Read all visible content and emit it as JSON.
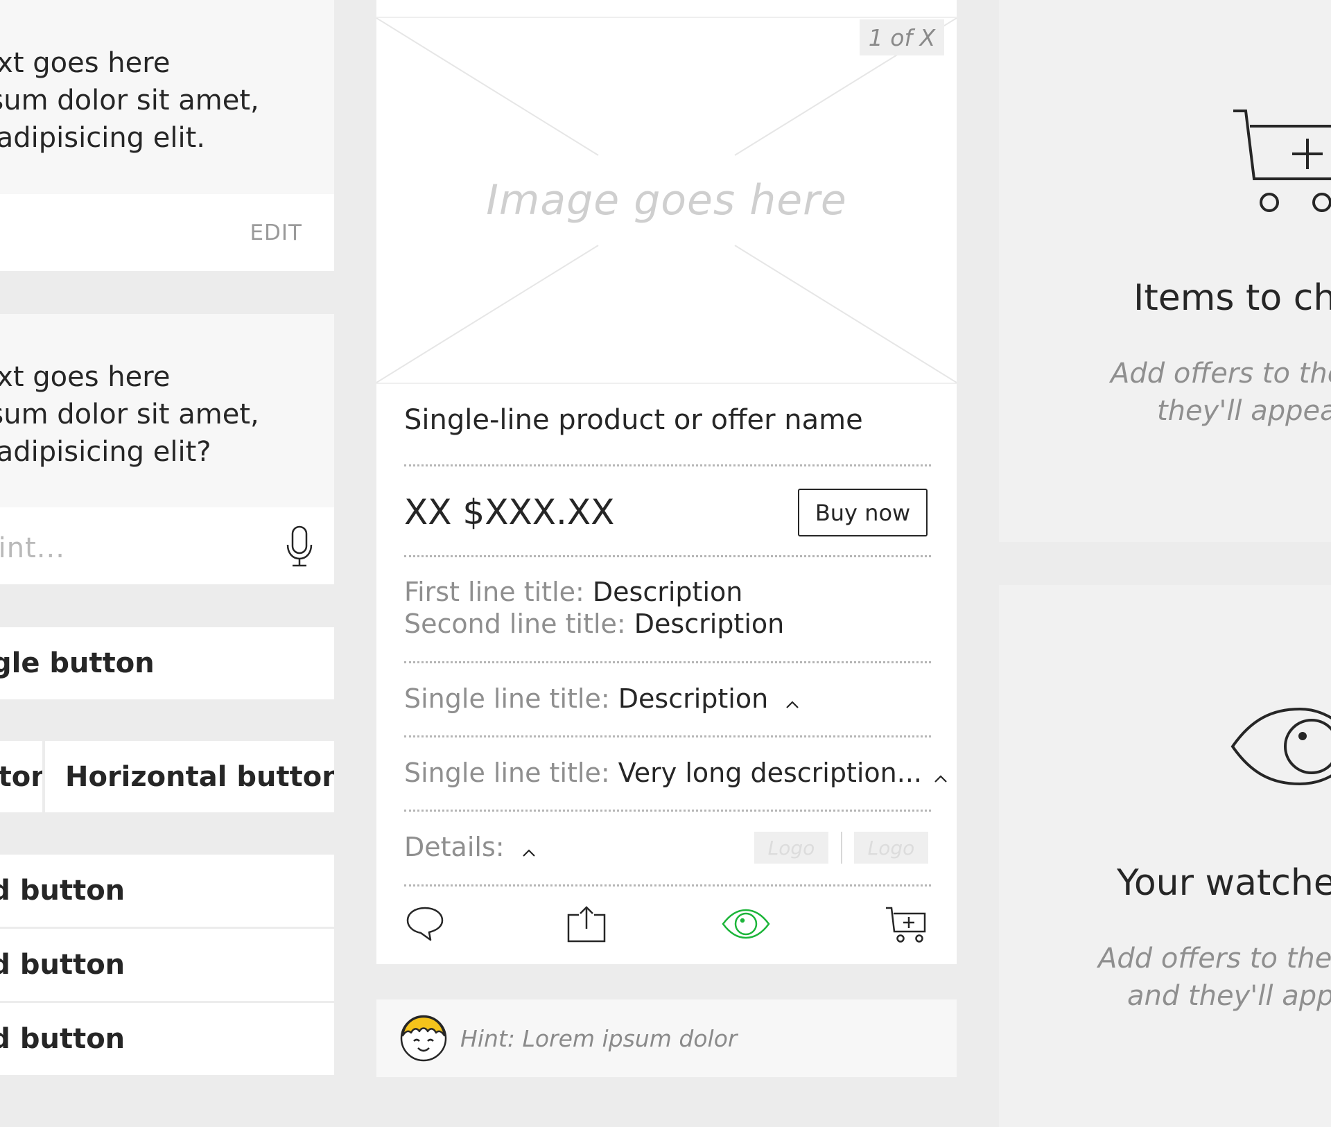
{
  "left": {
    "question_card_1": {
      "lines": [
        "Question text goes here",
        "Lorem ipsum dolor sit amet,",
        "consectetur adipisicing elit."
      ],
      "edit_label": "EDIT"
    },
    "question_card_2": {
      "lines": [
        "Question text goes here",
        "Lorem ipsum dolor sit amet,",
        "consectetur adipisicing elit?"
      ],
      "input_placeholder": "Reply with a hint..."
    },
    "single_button_label": "Single button",
    "horizontal_buttons": [
      "Horizontal button",
      "Horizontal button"
    ],
    "stacked_buttons": [
      "Stacked button",
      "Stacked button",
      "Stacked button"
    ]
  },
  "product": {
    "pager": "1 of X",
    "image_placeholder": "Image goes here",
    "name": "Single-line product or offer name",
    "price": "XX $XXX.XX",
    "buy_label": "Buy now",
    "spec_first_key": "First line title:",
    "spec_first_val": "Description",
    "spec_second_key": "Second line title:",
    "spec_second_val": "Description",
    "spec_single_key": "Single line title:",
    "spec_single_val": "Description",
    "spec_long_key": "Single line title:",
    "spec_long_val": "Very long description...",
    "details_label": "Details:",
    "logos": [
      "Logo",
      "Logo"
    ],
    "accent_color": "#1db53a"
  },
  "hint": {
    "text": "Hint: Lorem ipsum dolor",
    "avatar_color": "#f4c31b"
  },
  "right": {
    "cart_title": "Items to check out",
    "cart_sub_lines": [
      "Add offers to the cart and",
      "they'll appear here"
    ],
    "watch_title": "Your watched items",
    "watch_sub_lines": [
      "Add offers to the watch list",
      "and they'll appear here"
    ]
  }
}
